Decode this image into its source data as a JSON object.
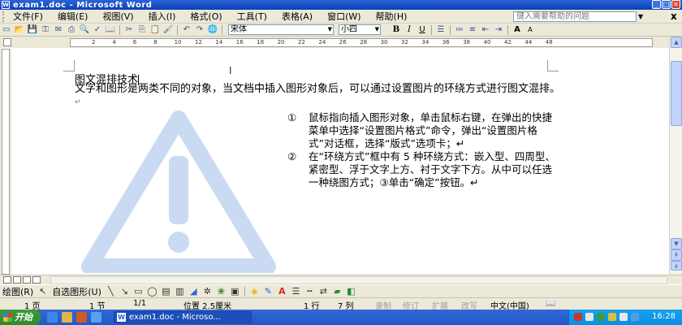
{
  "window": {
    "title": "exam1.doc - Microsoft Word",
    "app_icon": "W",
    "buttons": [
      "minimize",
      "maximize",
      "close"
    ]
  },
  "menu": {
    "items": [
      "文件(F)",
      "编辑(E)",
      "视图(V)",
      "插入(I)",
      "格式(O)",
      "工具(T)",
      "表格(A)",
      "窗口(W)",
      "帮助(H)"
    ],
    "help_placeholder": "键入需要帮助的问题",
    "close_doc": "x"
  },
  "toolbar": {
    "font": "宋体",
    "size": "小四",
    "bold": "B",
    "italic": "I",
    "underline": "U",
    "icons": [
      "new-icon",
      "open-icon",
      "save-icon",
      "permission-icon",
      "email-icon",
      "print-icon",
      "print-preview-icon",
      "spelling-icon",
      "research-icon",
      "cut-icon",
      "copy-icon",
      "paste-icon",
      "format-painter-icon",
      "undo-icon",
      "redo-icon",
      "hyperlink-icon"
    ],
    "font_grow": "A",
    "font_shrink": "A"
  },
  "ruler": {
    "numbers": [
      "2",
      "4",
      "6",
      "8",
      "10",
      "12",
      "14",
      "16",
      "18",
      "20",
      "22",
      "24",
      "26",
      "28",
      "30",
      "32",
      "34",
      "36",
      "38",
      "40",
      "42",
      "44",
      "48"
    ]
  },
  "document": {
    "heading": "图文混排技术",
    "paragraph": "文字和图形是两类不同的对象，当文档中插入图形对象后，可以通过设置图片的环绕方式进行图文混排。",
    "paragraph_mark": "↵",
    "list": [
      {
        "num": "①",
        "text": "鼠标指向插入图形对象，单击鼠标右键，在弹出的快捷菜单中选择“设置图片格式”命令，弹出“设置图片格式”对话框，选择“版式”选项卡；↵"
      },
      {
        "num": "②",
        "text": "在“环绕方式”框中有 5 种环绕方式：嵌入型、四周型、紧密型、浮于文字上方、衬于文字下方。从中可以任选一种绕图方式；③单击“确定”按钮。↵"
      }
    ],
    "warning_image": "warning-triangle-icon",
    "warning_color": "#c9daf2"
  },
  "drawbar": {
    "draw_label": "绘图(R)",
    "autoshape_label": "自选图形(U)"
  },
  "statusbar": {
    "page": "1 页",
    "section": "1 节",
    "page_of": "1/1",
    "position": "位置 2.5厘米",
    "line": "1 行",
    "column": "7 列",
    "rec": "录制",
    "trk": "修订",
    "ext": "扩展",
    "ovr": "改写",
    "language": "中文(中国)"
  },
  "taskbar": {
    "start": "开始",
    "task_label": "exam1.doc - Microso...",
    "clock": "16:28"
  }
}
